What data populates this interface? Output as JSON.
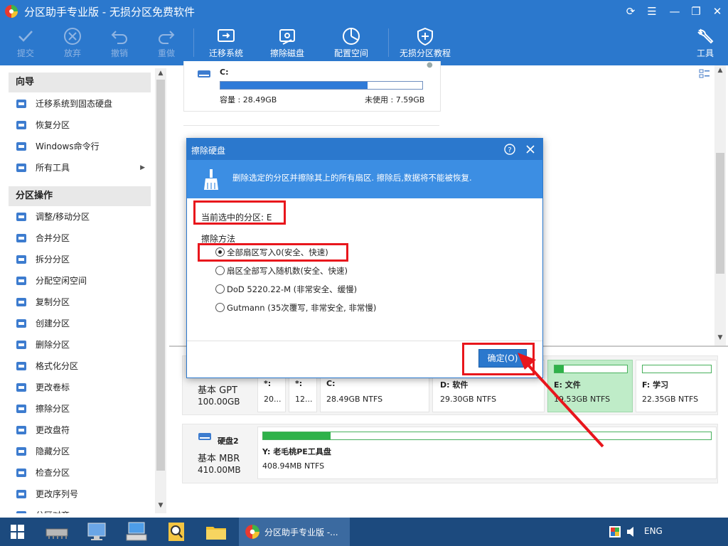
{
  "app": {
    "title": "分区助手专业版 - 无损分区免费软件"
  },
  "toolbar": {
    "submit": "提交",
    "discard": "放弃",
    "undo": "撤销",
    "redo": "重做",
    "migrate": "迁移系统",
    "wipe_disk": "擦除磁盘",
    "allocate": "配置空间",
    "tutorial": "无损分区教程",
    "tools": "工具"
  },
  "sidebar": {
    "wizard_title": "向导",
    "wizard_items": [
      {
        "label": "迁移系统到固态硬盘",
        "icon": "migrate-icon"
      },
      {
        "label": "恢复分区",
        "icon": "recover-icon"
      },
      {
        "label": "Windows命令行",
        "icon": "windows-icon"
      },
      {
        "label": "所有工具",
        "icon": "tools-grid-icon"
      }
    ],
    "ops_title": "分区操作",
    "ops_items": [
      {
        "label": "调整/移动分区",
        "icon": "resize-icon"
      },
      {
        "label": "合并分区",
        "icon": "merge-icon"
      },
      {
        "label": "拆分分区",
        "icon": "split-icon"
      },
      {
        "label": "分配空闲空间",
        "icon": "allocate-icon"
      },
      {
        "label": "复制分区",
        "icon": "copy-icon"
      },
      {
        "label": "创建分区",
        "icon": "create-icon"
      },
      {
        "label": "删除分区",
        "icon": "delete-icon"
      },
      {
        "label": "格式化分区",
        "icon": "format-icon"
      },
      {
        "label": "更改卷标",
        "icon": "label-icon"
      },
      {
        "label": "擦除分区",
        "icon": "wipe-icon"
      },
      {
        "label": "更改盘符",
        "icon": "letter-icon"
      },
      {
        "label": "隐藏分区",
        "icon": "hide-icon"
      },
      {
        "label": "检查分区",
        "icon": "check-icon"
      },
      {
        "label": "更改序列号",
        "icon": "serial-icon"
      },
      {
        "label": "分区对齐",
        "icon": "align-icon"
      }
    ]
  },
  "top_card": {
    "drive": "C:",
    "capacity": "容量 : 28.49GB",
    "unused": "未使用 : 7.59GB",
    "used_fraction": 0.73
  },
  "disk1": {
    "type": "基本 GPT",
    "size": "100.00GB",
    "partitions": [
      {
        "name": "*:",
        "info": "20..."
      },
      {
        "name": "*:",
        "info": "12..."
      },
      {
        "name": "C:",
        "info": "28.49GB NTFS"
      },
      {
        "name": "D: 软件",
        "info": "29.30GB NTFS"
      },
      {
        "name": "E: 文件",
        "info": "19.53GB NTFS",
        "used_fraction": 0.13
      },
      {
        "name": "F: 学习",
        "info": "22.35GB NTFS",
        "used_fraction": 0.0
      }
    ]
  },
  "disk2": {
    "name": "硬盘2",
    "type": "基本 MBR",
    "size": "410.00MB",
    "partition": {
      "name": "Y: 老毛桃PE工具盘",
      "info": "408.94MB NTFS",
      "used_fraction": 0.15
    }
  },
  "dialog": {
    "title": "擦除硬盘",
    "banner": "删除选定的分区并擦除其上的所有扇区. 擦除后,数据将不能被恢复.",
    "current_partition": "当前选中的分区: E",
    "method_label": "擦除方法",
    "options": [
      {
        "label": "全部扇区写入0(安全、快速)",
        "selected": true
      },
      {
        "label": "扇区全部写入随机数(安全、快速)",
        "selected": false
      },
      {
        "label": "DoD 5220.22-M (非常安全、缓慢)",
        "selected": false
      },
      {
        "label": "Gutmann (35次覆写, 非常安全, 非常慢)",
        "selected": false
      }
    ],
    "ok": "确定(O)"
  },
  "taskbar": {
    "active_app": "分区助手专业版 -...",
    "lang": "ENG"
  },
  "colors": {
    "accent": "#2b78cd",
    "highlight": "#e8161c",
    "used_bar": "#2f7ad8",
    "green_bar": "#2fb24a"
  }
}
